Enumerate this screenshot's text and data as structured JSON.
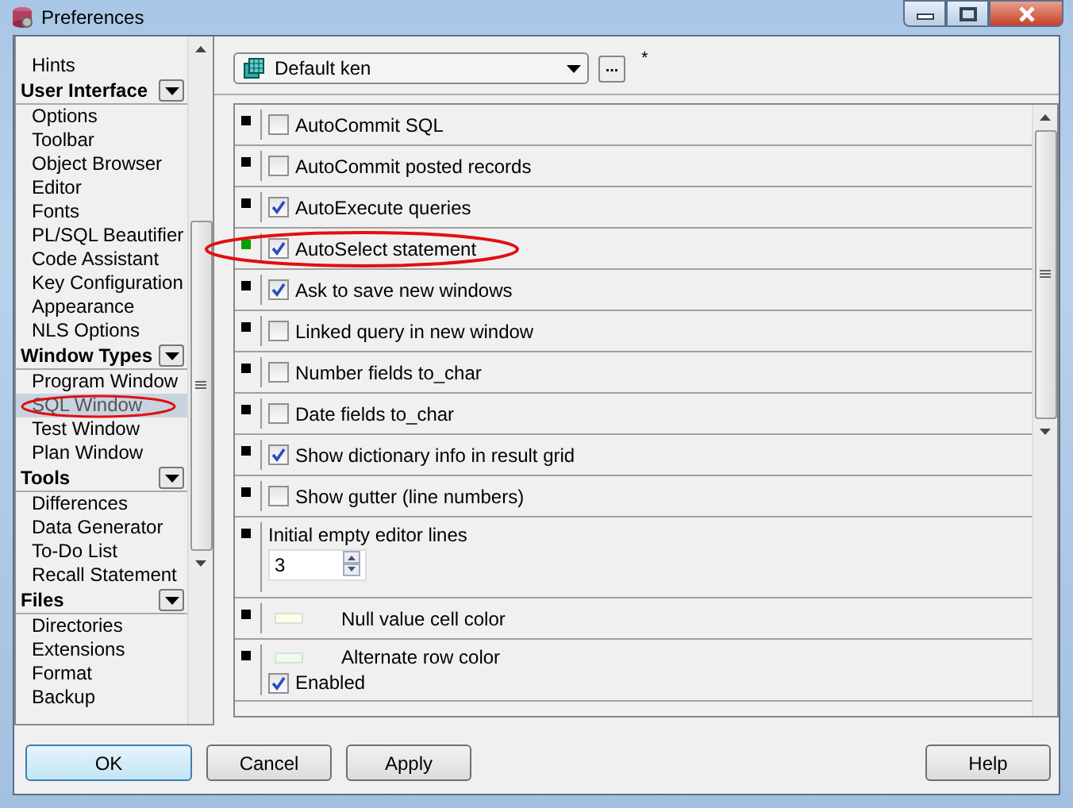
{
  "window": {
    "title": "Preferences"
  },
  "sidebar": {
    "groups": [
      {
        "items": [
          {
            "label": "Hints",
            "selected": false
          }
        ]
      },
      {
        "title": "User Interface",
        "items": [
          {
            "label": "Options",
            "selected": false
          },
          {
            "label": "Toolbar",
            "selected": false
          },
          {
            "label": "Object Browser",
            "selected": false
          },
          {
            "label": "Editor",
            "selected": false
          },
          {
            "label": "Fonts",
            "selected": false
          },
          {
            "label": "PL/SQL Beautifier",
            "selected": false
          },
          {
            "label": "Code Assistant",
            "selected": false
          },
          {
            "label": "Key Configuration",
            "selected": false
          },
          {
            "label": "Appearance",
            "selected": false
          },
          {
            "label": "NLS Options",
            "selected": false
          }
        ]
      },
      {
        "title": "Window Types",
        "items": [
          {
            "label": "Program Window",
            "selected": false
          },
          {
            "label": "SQL Window",
            "selected": true
          },
          {
            "label": "Test Window",
            "selected": false
          },
          {
            "label": "Plan Window",
            "selected": false
          }
        ]
      },
      {
        "title": "Tools",
        "items": [
          {
            "label": "Differences",
            "selected": false
          },
          {
            "label": "Data Generator",
            "selected": false
          },
          {
            "label": "To-Do List",
            "selected": false
          },
          {
            "label": "Recall Statement",
            "selected": false
          }
        ]
      },
      {
        "title": "Files",
        "items": [
          {
            "label": "Directories",
            "selected": false
          },
          {
            "label": "Extensions",
            "selected": false
          },
          {
            "label": "Format",
            "selected": false
          },
          {
            "label": "Backup",
            "selected": false
          }
        ]
      }
    ]
  },
  "profile": {
    "value": "Default ken",
    "browse": "...",
    "modified": "*"
  },
  "options": [
    {
      "kind": "checkbox",
      "label": "AutoCommit SQL",
      "checked": false,
      "modified": false
    },
    {
      "kind": "checkbox",
      "label": "AutoCommit posted records",
      "checked": false,
      "modified": false
    },
    {
      "kind": "checkbox",
      "label": "AutoExecute queries",
      "checked": true,
      "modified": false
    },
    {
      "kind": "checkbox",
      "label": "AutoSelect statement",
      "checked": true,
      "modified": true
    },
    {
      "kind": "checkbox",
      "label": "Ask to save new windows",
      "checked": true,
      "modified": false
    },
    {
      "kind": "checkbox",
      "label": "Linked query in new window",
      "checked": false,
      "modified": false
    },
    {
      "kind": "checkbox",
      "label": "Number fields to_char",
      "checked": false,
      "modified": false
    },
    {
      "kind": "checkbox",
      "label": "Date fields to_char",
      "checked": false,
      "modified": false
    },
    {
      "kind": "checkbox",
      "label": "Show dictionary info in result grid",
      "checked": true,
      "modified": false
    },
    {
      "kind": "checkbox",
      "label": "Show gutter (line numbers)",
      "checked": false,
      "modified": false
    },
    {
      "kind": "spinner",
      "label": "Initial empty editor lines",
      "value": "3",
      "modified": false
    },
    {
      "kind": "swatch",
      "label": "Null value cell color",
      "color": "#ffffe6",
      "modified": false
    },
    {
      "kind": "swatch",
      "label": "Alternate row color",
      "color": "#e6ffe6",
      "modified": false,
      "toggle": {
        "label": "Enabled",
        "checked": true
      }
    }
  ],
  "buttons": [
    {
      "label": "OK",
      "default": true
    },
    {
      "label": "Cancel",
      "default": false
    },
    {
      "label": "Apply",
      "default": false
    },
    {
      "label": "Help",
      "default": false
    }
  ]
}
